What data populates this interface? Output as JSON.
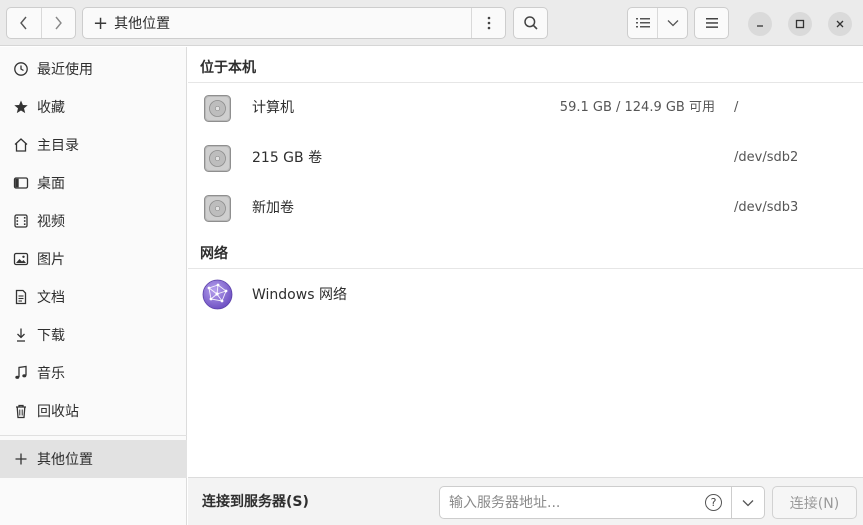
{
  "header": {
    "location_label": "其他位置",
    "icons": {
      "back": "chevron-left-icon",
      "forward": "chevron-right-icon",
      "more": "vertical-dots-icon",
      "search": "search-icon",
      "list_view": "list-view-icon",
      "view_options": "chevron-down-icon",
      "menu": "hamburger-menu-icon",
      "minimize": "minimize-icon",
      "maximize": "maximize-icon",
      "close": "close-icon"
    }
  },
  "sidebar": {
    "items": [
      {
        "label": "最近使用",
        "icon": "clock-icon"
      },
      {
        "label": "收藏",
        "icon": "star-icon"
      },
      {
        "label": "主目录",
        "icon": "home-icon"
      },
      {
        "label": "桌面",
        "icon": "desktop-icon"
      },
      {
        "label": "视频",
        "icon": "video-icon"
      },
      {
        "label": "图片",
        "icon": "picture-icon"
      },
      {
        "label": "文档",
        "icon": "document-icon"
      },
      {
        "label": "下载",
        "icon": "download-icon"
      },
      {
        "label": "音乐",
        "icon": "music-icon"
      },
      {
        "label": "回收站",
        "icon": "trash-icon"
      }
    ],
    "other_locations": {
      "label": "其他位置",
      "icon": "plus-icon",
      "selected": true
    }
  },
  "main": {
    "on_this_computer": {
      "heading": "位于本机",
      "volumes": [
        {
          "name": "计算机",
          "usage": "59.1 GB / 124.9 GB 可用",
          "mount": "/"
        },
        {
          "name": "215 GB 卷",
          "usage": "",
          "mount": "/dev/sdb2"
        },
        {
          "name": "新加卷",
          "usage": "",
          "mount": "/dev/sdb3"
        }
      ]
    },
    "network": {
      "heading": "网络",
      "items": [
        {
          "name": "Windows 网络",
          "icon": "network-globe-icon"
        }
      ]
    }
  },
  "bottom": {
    "connect_label": "连接到服务器(S)",
    "server_placeholder": "输入服务器地址...",
    "help_glyph": "?",
    "connect_button": "连接(N)"
  },
  "colors": {
    "accent_network": "#7b5ccc",
    "headerbar_bg": "#ebebeb",
    "sidebar_selected_bg": "#e2e2e2"
  }
}
